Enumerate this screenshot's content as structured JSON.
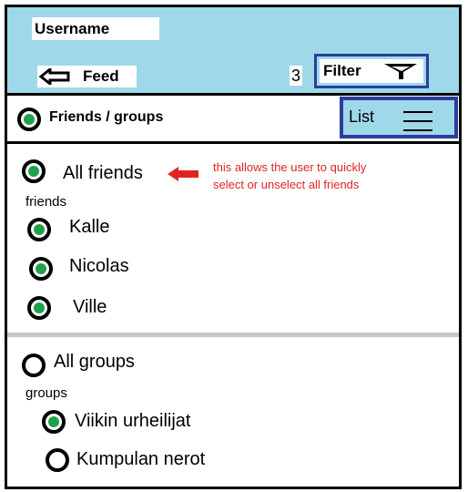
{
  "header": {
    "username": "Username",
    "feed_label": "Feed",
    "filter_count": "3",
    "filter_label": "Filter"
  },
  "subbar": {
    "title": "Friends / groups",
    "list_label": "List"
  },
  "friends": {
    "all_label": "All friends",
    "section_label": "friends",
    "note": "this allows the user to quickly select or unselect all friends",
    "items": [
      {
        "label": "Kalle",
        "selected": true
      },
      {
        "label": "Nicolas",
        "selected": true
      },
      {
        "label": "Ville",
        "selected": true
      }
    ]
  },
  "groups": {
    "all_label": "All groups",
    "section_label": "groups",
    "items": [
      {
        "label": "Viikin urheilijat",
        "selected": true
      },
      {
        "label": "Kumpulan nerot",
        "selected": false
      }
    ]
  },
  "colors": {
    "header_bg": "#9ed8e9",
    "accent_border": "#2d3d9b",
    "radio_fill": "#1fa04b",
    "annotation": "#e02424"
  },
  "icons": [
    "back-arrow-icon",
    "filter-funnel-icon",
    "hamburger-menu-icon",
    "radio-selected-icon",
    "radio-unselected-icon",
    "red-arrow-icon"
  ]
}
